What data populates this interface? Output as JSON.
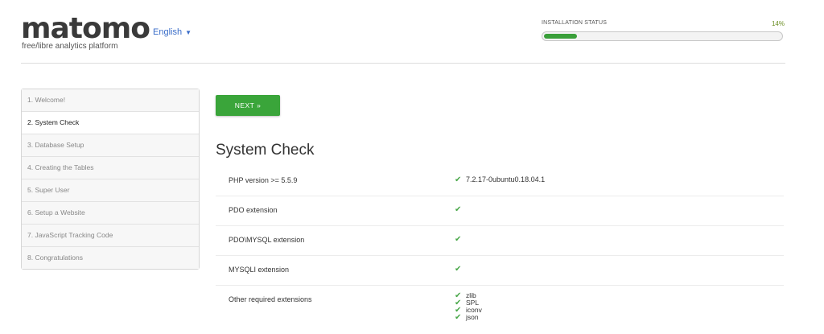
{
  "header": {
    "logo": "matomo",
    "tagline": "free/libre analytics platform",
    "language": "English",
    "status_label": "INSTALLATION STATUS",
    "status_percent_label": "14%",
    "progress": 0.14
  },
  "steps": [
    "1. Welcome!",
    "2. System Check",
    "3. Database Setup",
    "4. Creating the Tables",
    "5. Super User",
    "6. Setup a Website",
    "7. JavaScript Tracking Code",
    "8. Congratulations"
  ],
  "current_step_index": 1,
  "main": {
    "next_label": "NEXT »",
    "title": "System Check",
    "checks": [
      {
        "label": "PHP version >= 5.5.9",
        "value": "7.2.17-0ubuntu0.18.04.1"
      },
      {
        "label": "PDO extension",
        "value": ""
      },
      {
        "label": "PDO\\MYSQL extension",
        "value": ""
      },
      {
        "label": "MYSQLI extension",
        "value": ""
      }
    ],
    "other_label": "Other required extensions",
    "other_extensions": [
      "zlib",
      "SPL",
      "iconv",
      "json"
    ]
  },
  "colors": {
    "accent_green": "#3aa53a",
    "link_blue": "#3a6dc9"
  },
  "icons": {
    "check": "checkmark-icon",
    "caret": "caret-down-icon"
  }
}
